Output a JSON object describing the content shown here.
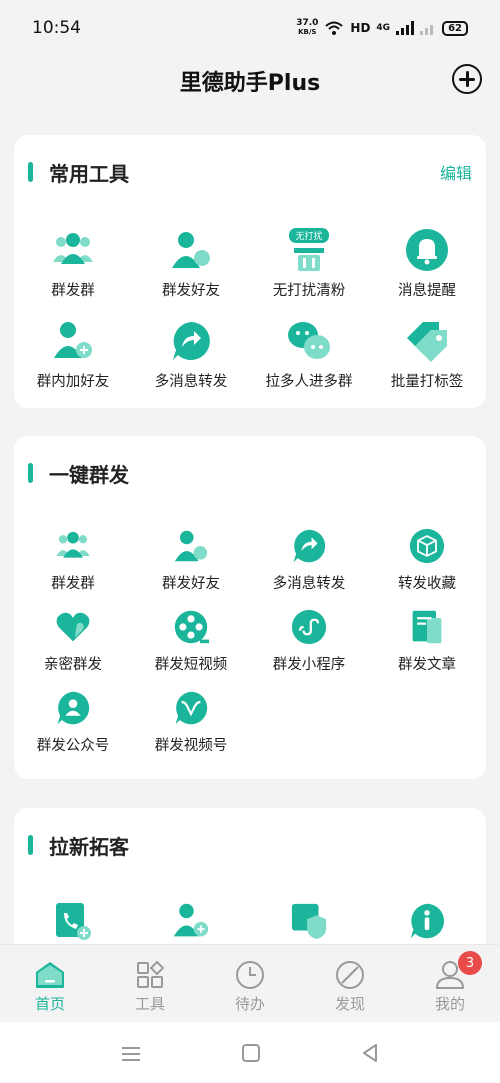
{
  "status_bar": {
    "time": "10:54",
    "net_speed": "37.0",
    "net_unit": "KB/S",
    "hd": "HD",
    "signal": "4G",
    "battery": "62"
  },
  "header": {
    "title": "里德助手Plus"
  },
  "common_tools": {
    "title": "常用工具",
    "action": "编辑",
    "items": [
      {
        "label": "群发群",
        "icon": "group-icon"
      },
      {
        "label": "群发好友",
        "icon": "friends-icon"
      },
      {
        "label": "无打扰清粉",
        "icon": "clean-icon",
        "tag": "无打扰"
      },
      {
        "label": "消息提醒",
        "icon": "bell-icon"
      },
      {
        "label": "群内加好友",
        "icon": "add-user-icon"
      },
      {
        "label": "多消息转发",
        "icon": "forward-icon"
      },
      {
        "label": "拉多人进多群",
        "icon": "chat-icon"
      },
      {
        "label": "批量打标签",
        "icon": "tag-icon"
      }
    ]
  },
  "one_click": {
    "title": "一键群发",
    "items": [
      {
        "label": "群发群",
        "icon": "group-icon"
      },
      {
        "label": "群发好友",
        "icon": "friends-icon"
      },
      {
        "label": "多消息转发",
        "icon": "forward-icon"
      },
      {
        "label": "转发收藏",
        "icon": "box-icon"
      },
      {
        "label": "亲密群发",
        "icon": "heart-icon"
      },
      {
        "label": "群发短视频",
        "icon": "film-icon"
      },
      {
        "label": "群发小程序",
        "icon": "miniprogram-icon"
      },
      {
        "label": "群发文章",
        "icon": "article-icon"
      },
      {
        "label": "群发公众号",
        "icon": "official-account-icon"
      },
      {
        "label": "群发视频号",
        "icon": "channels-icon"
      }
    ]
  },
  "acquire": {
    "title": "拉新拓客",
    "items": [
      {
        "icon": "phone-book-icon"
      },
      {
        "icon": "add-user-icon"
      },
      {
        "icon": "shield-icon"
      },
      {
        "icon": "info-icon"
      }
    ]
  },
  "bottom_nav": {
    "items": [
      {
        "label": "首页",
        "icon": "home-icon"
      },
      {
        "label": "工具",
        "icon": "grid-icon"
      },
      {
        "label": "待办",
        "icon": "clock-icon"
      },
      {
        "label": "发现",
        "icon": "compass-icon"
      },
      {
        "label": "我的",
        "icon": "profile-icon",
        "badge": "3"
      }
    ]
  },
  "colors": {
    "accent": "#1bb59b",
    "accent_light": "#7fdcc9",
    "badge": "#e94b4b"
  }
}
